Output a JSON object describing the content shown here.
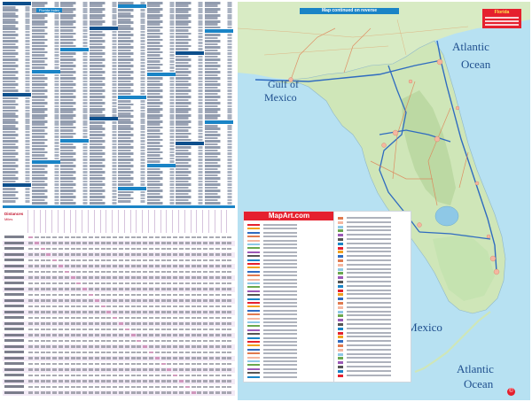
{
  "index": {
    "header_label": "Florida Index"
  },
  "distance_table": {
    "title": "Distances",
    "subtitle": "Miles"
  },
  "map": {
    "top_banner": "Map continued on reverse",
    "title_box": "Florida",
    "labels": {
      "atlantic": "Atlantic",
      "ocean": "Ocean",
      "gulf_of": "Gulf of",
      "mexico": "Mexico",
      "gulf_of_mexico": "Gulf of Mexico",
      "atlantic2": "Atlantic",
      "ocean2": "Ocean"
    },
    "legend_brand": "MapArt.com",
    "colors": {
      "water": "#b7e1f2",
      "land": "#cfe6b8",
      "land_dark": "#bcd9a3",
      "brand_red": "#e5202e",
      "accent_blue": "#1a84c6"
    }
  }
}
